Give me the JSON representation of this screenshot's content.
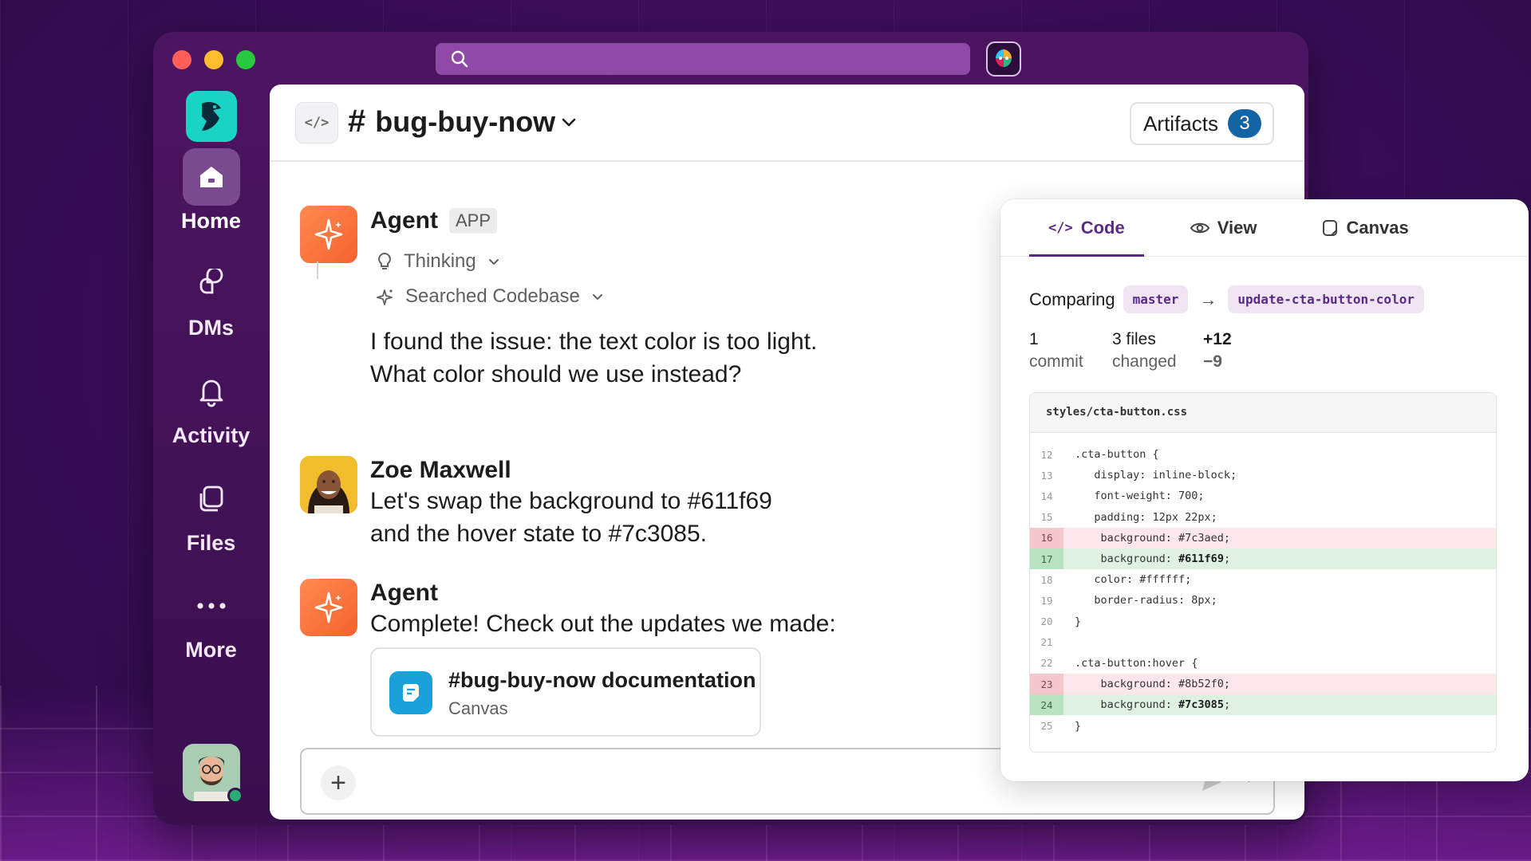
{
  "search": {
    "placeholder": ""
  },
  "sidebar": {
    "items": [
      {
        "label": "Home",
        "icon": "home-icon",
        "active": true
      },
      {
        "label": "DMs",
        "icon": "dms-icon"
      },
      {
        "label": "Activity",
        "icon": "bell-icon"
      },
      {
        "label": "Files",
        "icon": "files-icon"
      },
      {
        "label": "More",
        "icon": "more-icon"
      }
    ]
  },
  "channel": {
    "name": "bug-buy-now",
    "hash": "#",
    "artifacts_label": "Artifacts",
    "artifacts_count": "3"
  },
  "messages": [
    {
      "sender": "Agent",
      "tag": "APP",
      "steps": [
        "Thinking",
        "Searched Codebase"
      ],
      "lines": [
        "I found the issue: the text color is too light.",
        "What color should we use instead?"
      ]
    },
    {
      "sender": "Zoe Maxwell",
      "lines": [
        "Let's swap the background to #611f69",
        "and the hover state to #7c3085."
      ]
    },
    {
      "sender": "Agent",
      "lines": [
        "Complete! Check out the updates we made:"
      ],
      "card": {
        "title": "#bug-buy-now documentation",
        "subtitle": "Canvas"
      }
    }
  ],
  "composer": {
    "plus": "+"
  },
  "panel": {
    "tabs": [
      {
        "label": "Code",
        "icon": "code-icon",
        "active": true
      },
      {
        "label": "View",
        "icon": "eye-icon"
      },
      {
        "label": "Canvas",
        "icon": "canvas-icon"
      }
    ],
    "comparing_label": "Comparing",
    "base_branch": "master",
    "arrow": "→",
    "head_branch": "update-cta-button-color",
    "stats": {
      "commits_num": "1",
      "commits_label": "commit",
      "files_num": "3 files",
      "files_label": "changed",
      "additions": "+12",
      "deletions": "−9"
    },
    "file_name": "styles/cta-button.css",
    "lines": [
      {
        "n": "12",
        "code": ".cta-button {",
        "type": "ctx"
      },
      {
        "n": "13",
        "code": "   display: inline-block;",
        "type": "ctx"
      },
      {
        "n": "14",
        "code": "   font-weight: 700;",
        "type": "ctx"
      },
      {
        "n": "15",
        "code": "   padding: 12px 22px;",
        "type": "ctx"
      },
      {
        "n": "16",
        "code": "    background: #7c3aed;",
        "type": "removed"
      },
      {
        "n": "17",
        "code": "    background: ",
        "hl": "#611f69",
        "tail": ";",
        "type": "added"
      },
      {
        "n": "18",
        "code": "   color: #ffffff;",
        "type": "ctx"
      },
      {
        "n": "19",
        "code": "   border-radius: 8px;",
        "type": "ctx"
      },
      {
        "n": "20",
        "code": "}",
        "type": "ctx"
      },
      {
        "n": "21",
        "code": "",
        "type": "ctx"
      },
      {
        "n": "22",
        "code": ".cta-button:hover {",
        "type": "ctx"
      },
      {
        "n": "23",
        "code": "    background: #8b52f0;",
        "type": "removed"
      },
      {
        "n": "24",
        "code": "    background: ",
        "hl": "#7c3085",
        "tail": ";",
        "type": "added"
      },
      {
        "n": "25",
        "code": "}",
        "type": "ctx"
      }
    ]
  },
  "colors": {
    "accent": "#5b2a86",
    "agent": "#f4622f",
    "logo": "#19d3c5",
    "badge": "#1264a3",
    "additions": "#18a046",
    "deletions": "#e01e5a"
  }
}
